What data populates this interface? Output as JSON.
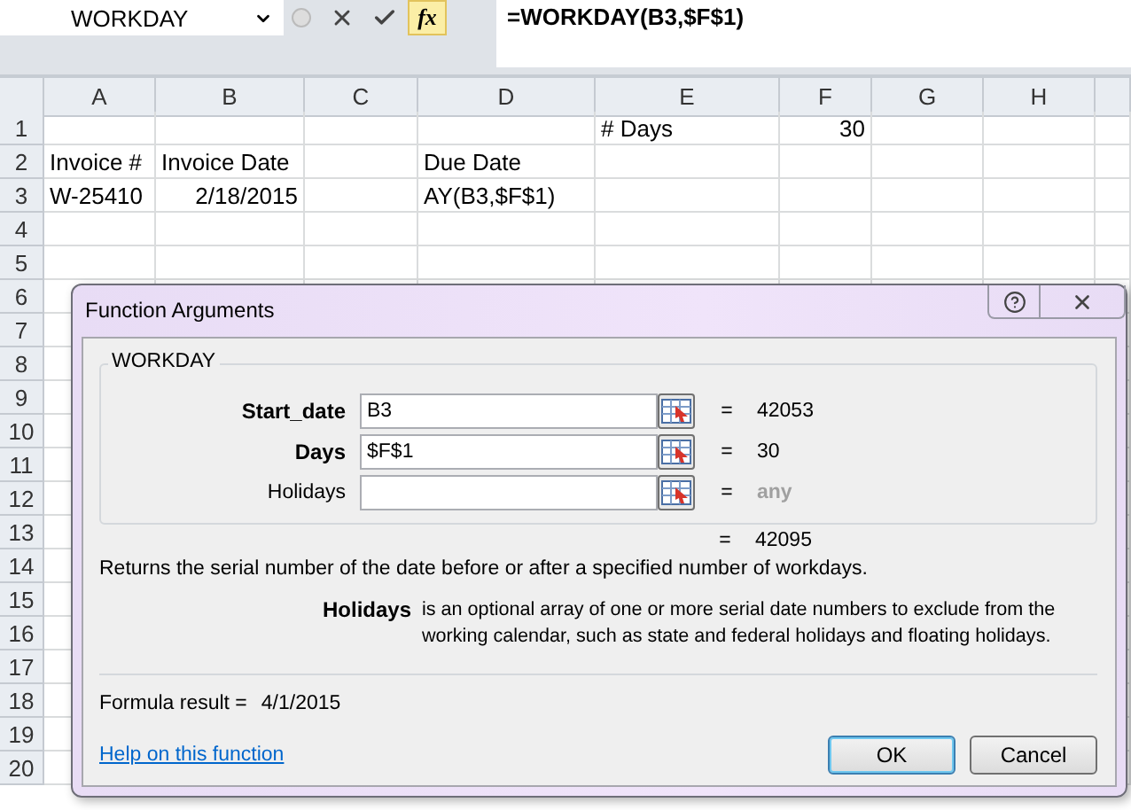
{
  "formula_bar": {
    "name_box": "WORKDAY",
    "fx_label": "fx",
    "formula": "=WORKDAY(B3,$F$1)"
  },
  "sheet": {
    "columns": [
      "A",
      "B",
      "C",
      "D",
      "E",
      "F",
      "G",
      "H"
    ],
    "rows": [
      {
        "number": "1",
        "cells": {
          "E": {
            "text": "# Days",
            "kind": "text"
          },
          "F": {
            "text": "30",
            "kind": "number"
          }
        }
      },
      {
        "number": "2",
        "cells": {
          "A": {
            "text": "Invoice #",
            "kind": "text"
          },
          "B": {
            "text": "Invoice Date",
            "kind": "text"
          },
          "D": {
            "text": "Due Date",
            "kind": "text"
          }
        }
      },
      {
        "number": "3",
        "cells": {
          "A": {
            "text": "W-25410",
            "kind": "text"
          },
          "B": {
            "text": "2/18/2015",
            "kind": "number"
          },
          "D": {
            "text": "AY(B3,$F$1)",
            "kind": "text"
          }
        }
      },
      {
        "number": "4"
      },
      {
        "number": "5"
      },
      {
        "number": "6"
      },
      {
        "number": "7"
      },
      {
        "number": "8"
      },
      {
        "number": "9"
      },
      {
        "number": "10"
      },
      {
        "number": "11"
      },
      {
        "number": "12"
      },
      {
        "number": "13"
      },
      {
        "number": "14"
      },
      {
        "number": "15"
      },
      {
        "number": "16"
      },
      {
        "number": "17"
      },
      {
        "number": "18"
      },
      {
        "number": "19"
      },
      {
        "number": "20"
      }
    ]
  },
  "dialog": {
    "title": "Function Arguments",
    "function_name": "WORKDAY",
    "arguments": [
      {
        "label": "Start_date",
        "required": true,
        "value": "B3",
        "sign": "=",
        "result_value": "42053",
        "evaluated": true
      },
      {
        "label": "Days",
        "required": true,
        "value": "$F$1",
        "sign": "=",
        "result_value": "30",
        "evaluated": true
      },
      {
        "label": "Holidays",
        "required": false,
        "sign": "=",
        "result_value": "any",
        "evaluated": false
      }
    ],
    "overall_result": {
      "sign": "=",
      "value": "42095"
    },
    "description": "Returns the serial number of the date before or after a specified number of workdays.",
    "argument_help": {
      "name": "Holidays",
      "text": "is an optional array of one or more serial date numbers to exclude from the working calendar, such as state and federal holidays and floating holidays."
    },
    "formula_result": {
      "label": "Formula result =",
      "value": "4/1/2015"
    },
    "help_link": "Help on this function",
    "buttons": [
      {
        "label": "OK",
        "default": true
      },
      {
        "label": "Cancel",
        "default": false
      }
    ]
  }
}
